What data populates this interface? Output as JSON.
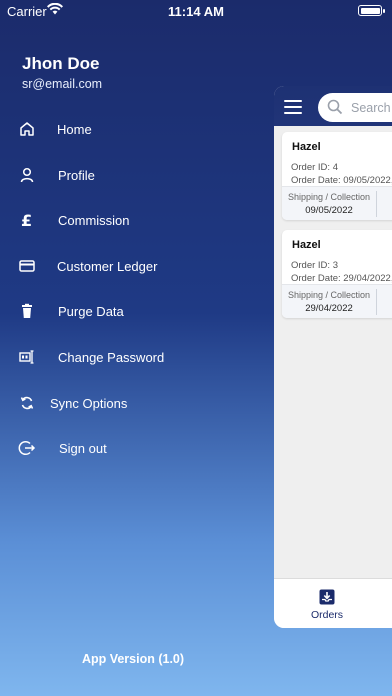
{
  "status_bar": {
    "carrier": "Carrier",
    "time": "11:14 AM"
  },
  "profile": {
    "name": "Jhon Doe",
    "email": "sr@email.com"
  },
  "menu": [
    {
      "label": "Home",
      "icon": "home-icon"
    },
    {
      "label": "Profile",
      "icon": "user-icon"
    },
    {
      "label": "Commission",
      "icon": "pound-icon"
    },
    {
      "label": "Customer Ledger",
      "icon": "credit-card-icon"
    },
    {
      "label": "Purge Data",
      "icon": "trash-icon"
    },
    {
      "label": "Change Password",
      "icon": "password-icon"
    },
    {
      "label": "Sync Options",
      "icon": "sync-icon"
    },
    {
      "label": "Sign out",
      "icon": "sign-out-icon"
    }
  ],
  "app_version": "App Version (1.0)",
  "search": {
    "placeholder": "Search"
  },
  "orders": [
    {
      "name": "Hazel",
      "order_id": "Order ID:  4",
      "order_date": "Order Date:  09/05/2022,",
      "shipping_label": "Shipping / Collection",
      "shipping_date": "09/05/2022"
    },
    {
      "name": "Hazel",
      "order_id": "Order ID:  3",
      "order_date": "Order Date:  29/04/2022,",
      "shipping_label": "Shipping / Collection",
      "shipping_date": "29/04/2022"
    }
  ],
  "tabbar": {
    "orders_label": "Orders"
  },
  "colors": {
    "accent": "#1b2b6b",
    "drawer_top": "#1b2b6b",
    "drawer_bottom": "#7fb6ee"
  }
}
